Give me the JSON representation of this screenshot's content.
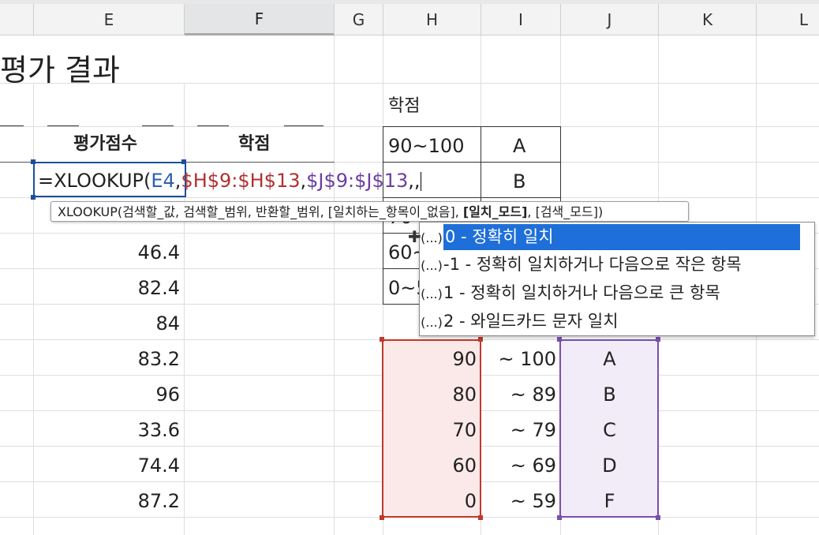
{
  "columns": [
    "E",
    "F",
    "G",
    "H",
    "I",
    "J",
    "K",
    "L"
  ],
  "title": "평가 결과",
  "header": {
    "score": "평가점수",
    "grade": "학점"
  },
  "grade_table_title": "학점",
  "grade_table": [
    {
      "range": "90~100",
      "grade": "A"
    },
    {
      "range": "",
      "grade": "B"
    },
    {
      "range": "70~",
      "grade": ""
    },
    {
      "range": "60~",
      "grade": ""
    },
    {
      "range": "0~5",
      "grade": ""
    }
  ],
  "formula": {
    "prefix": "=XLOOKUP(",
    "arg1": "E4",
    "sep1": ",",
    "arg2": "$H$9:$H$13",
    "sep2": ",",
    "arg3": "$J$9:$J$13",
    "suffix": ",,"
  },
  "tooltip": {
    "pre": "XLOOKUP(검색할_값, 검색할_범위, 반환할_범위, [일치하는_항목이_없음], ",
    "bold": "[일치_모드]",
    "post": ", [검색_모드])"
  },
  "dropdown": {
    "icon": "(...)",
    "items": [
      "0 - 정확히 일치",
      "-1 - 정확히 일치하거나 다음으로 작은 항목",
      "1 - 정확히 일치하거나 다음으로 큰 항목",
      "2 - 와일드카드 문자 일치"
    ]
  },
  "scores": [
    "46.4",
    "82.4",
    "84",
    "83.2",
    "96",
    "33.6",
    "74.4",
    "87.2"
  ],
  "lookup_table": [
    {
      "low": "90",
      "high": "~ 100",
      "grade": "A"
    },
    {
      "low": "80",
      "high": "~ 89",
      "grade": "B"
    },
    {
      "low": "70",
      "high": "~ 79",
      "grade": "C"
    },
    {
      "low": "60",
      "high": "~ 69",
      "grade": "D"
    },
    {
      "low": "0",
      "high": "~ 59",
      "grade": "F"
    }
  ]
}
